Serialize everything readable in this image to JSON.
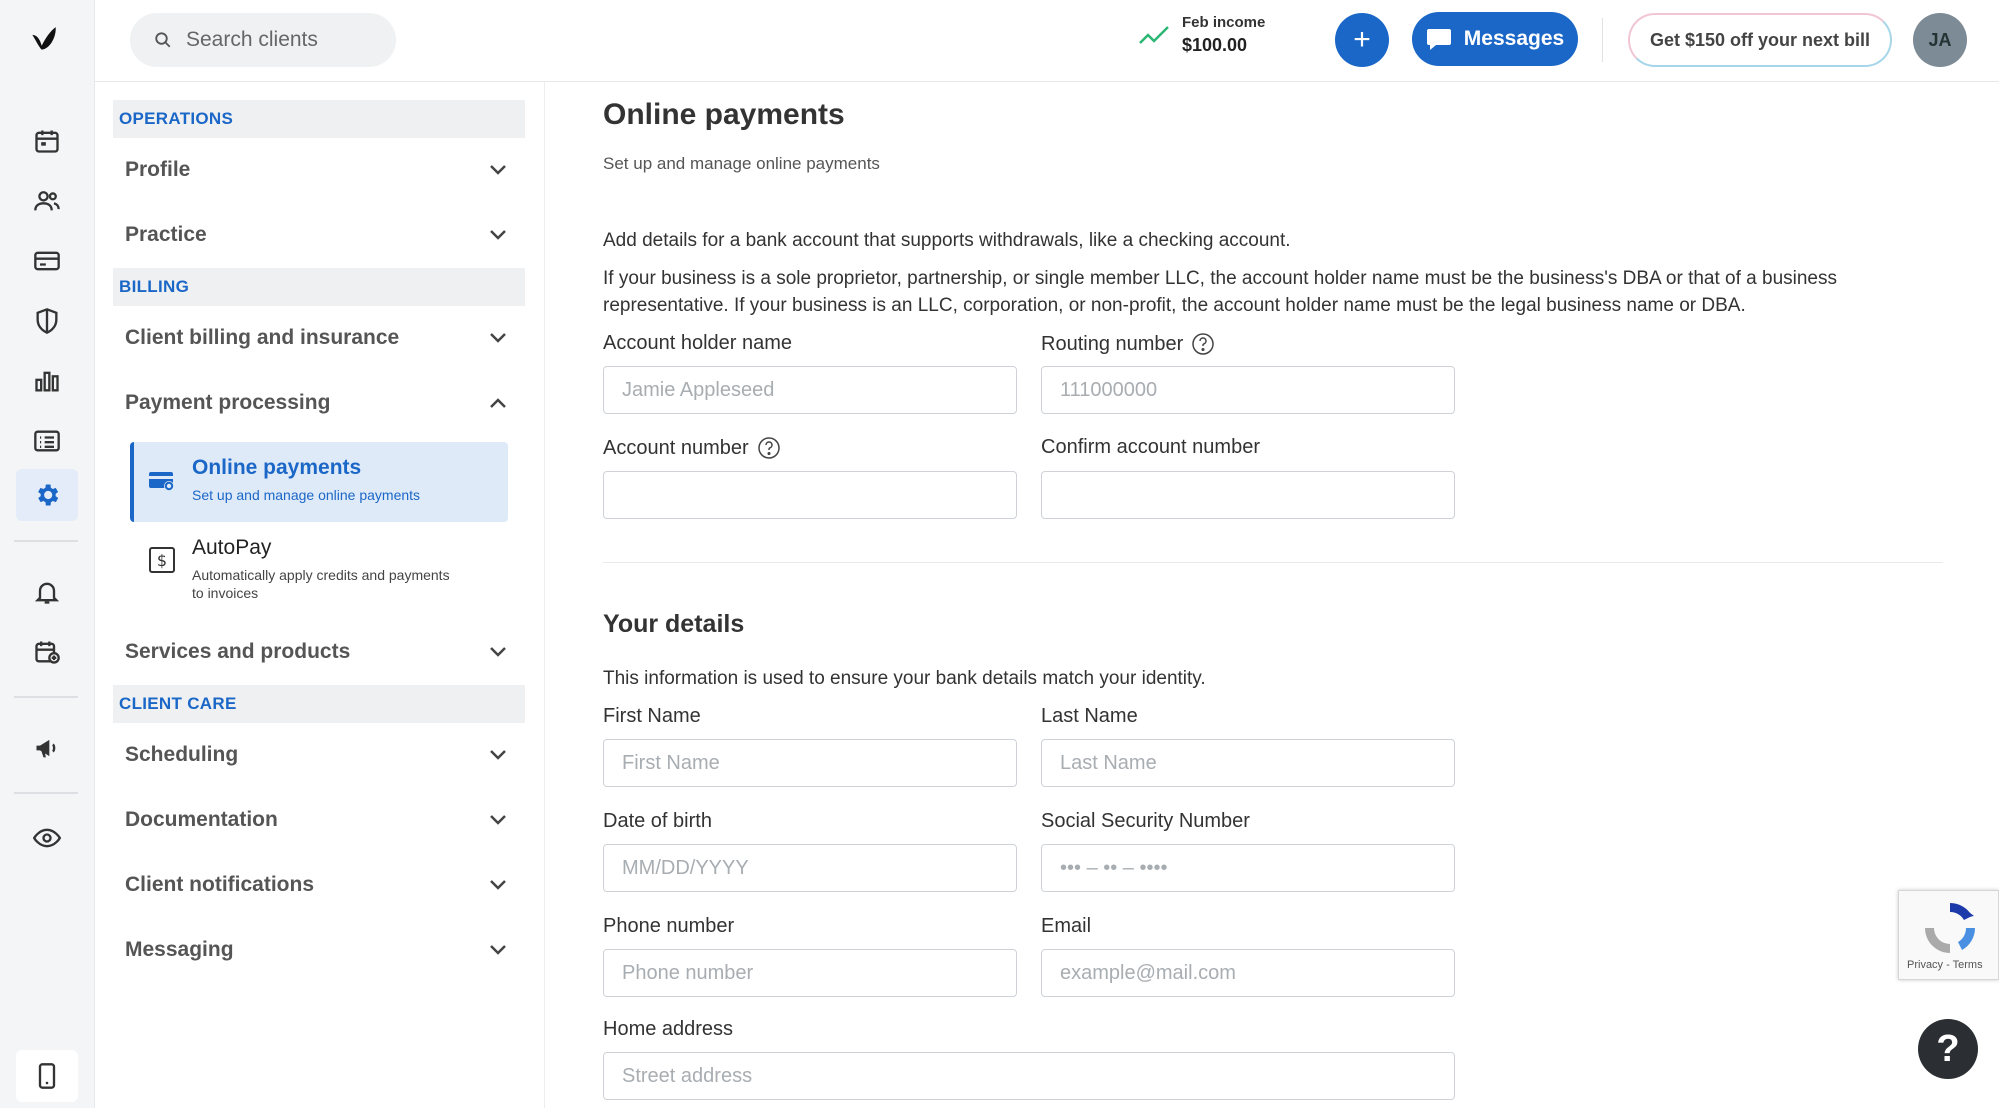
{
  "topbar": {
    "search_placeholder": "Search clients",
    "income_label": "Feb income",
    "income_value": "$100.00",
    "plus_label": "+",
    "messages_label": "Messages",
    "promo_label": "Get $150 off your next bill",
    "avatar_initials": "JA"
  },
  "rail": {
    "icons": [
      "logo-icon",
      "calendar-icon",
      "clients-icon",
      "billing-card-icon",
      "insurance-shield-icon",
      "analytics-icon",
      "list-icon",
      "settings-gear-icon",
      "bell-icon",
      "calendar-add-icon",
      "megaphone-icon",
      "eye-icon",
      "mobile-icon"
    ],
    "active": "settings-gear-icon"
  },
  "nav": {
    "operations": "OPERATIONS",
    "profile": "Profile",
    "practice": "Practice",
    "billing": "BILLING",
    "client_billing": "Client billing and insurance",
    "payment_processing": "Payment processing",
    "online_payments": {
      "title": "Online payments",
      "desc": "Set up and manage online payments"
    },
    "autopay": {
      "title": "AutoPay",
      "desc_line1": "Automatically apply credits and payments",
      "desc_line2": "to invoices"
    },
    "services": "Services and products",
    "client_care": "CLIENT CARE",
    "scheduling": "Scheduling",
    "documentation": "Documentation",
    "client_notifications": "Client notifications",
    "messaging": "Messaging"
  },
  "main": {
    "title": "Online payments",
    "subtitle": "Set up and manage online payments",
    "intro": "Add details for a bank account that supports withdrawals, like a checking account.",
    "notice": "If your business is a sole proprietor, partnership, or single member LLC, the account holder name must be the business's DBA or that of a business representative. If your business is an LLC, corporation, or non-profit, the account holder name must be the legal business name or DBA.",
    "bank": {
      "account_holder_label": "Account holder name",
      "account_holder_placeholder": "Jamie Appleseed",
      "routing_label": "Routing number",
      "routing_placeholder": "111000000",
      "account_number_label": "Account number",
      "confirm_label": "Confirm account number"
    },
    "details": {
      "title": "Your details",
      "desc": "This information is used to ensure your bank details match your identity.",
      "first_name_label": "First Name",
      "first_name_placeholder": "First Name",
      "last_name_label": "Last Name",
      "last_name_placeholder": "Last Name",
      "dob_label": "Date of birth",
      "dob_placeholder": "MM/DD/YYYY",
      "ssn_label": "Social Security Number",
      "ssn_placeholder": "••• – •• – ••••",
      "phone_label": "Phone number",
      "phone_placeholder": "Phone number",
      "email_label": "Email",
      "email_placeholder": "example@mail.com",
      "address_label": "Home address",
      "address_placeholder": "Street address"
    }
  },
  "widgets": {
    "recaptcha_links": "Privacy - Terms",
    "help_label": "?"
  },
  "colors": {
    "accent": "#1b67c7",
    "income_trend": "#2bb673"
  }
}
